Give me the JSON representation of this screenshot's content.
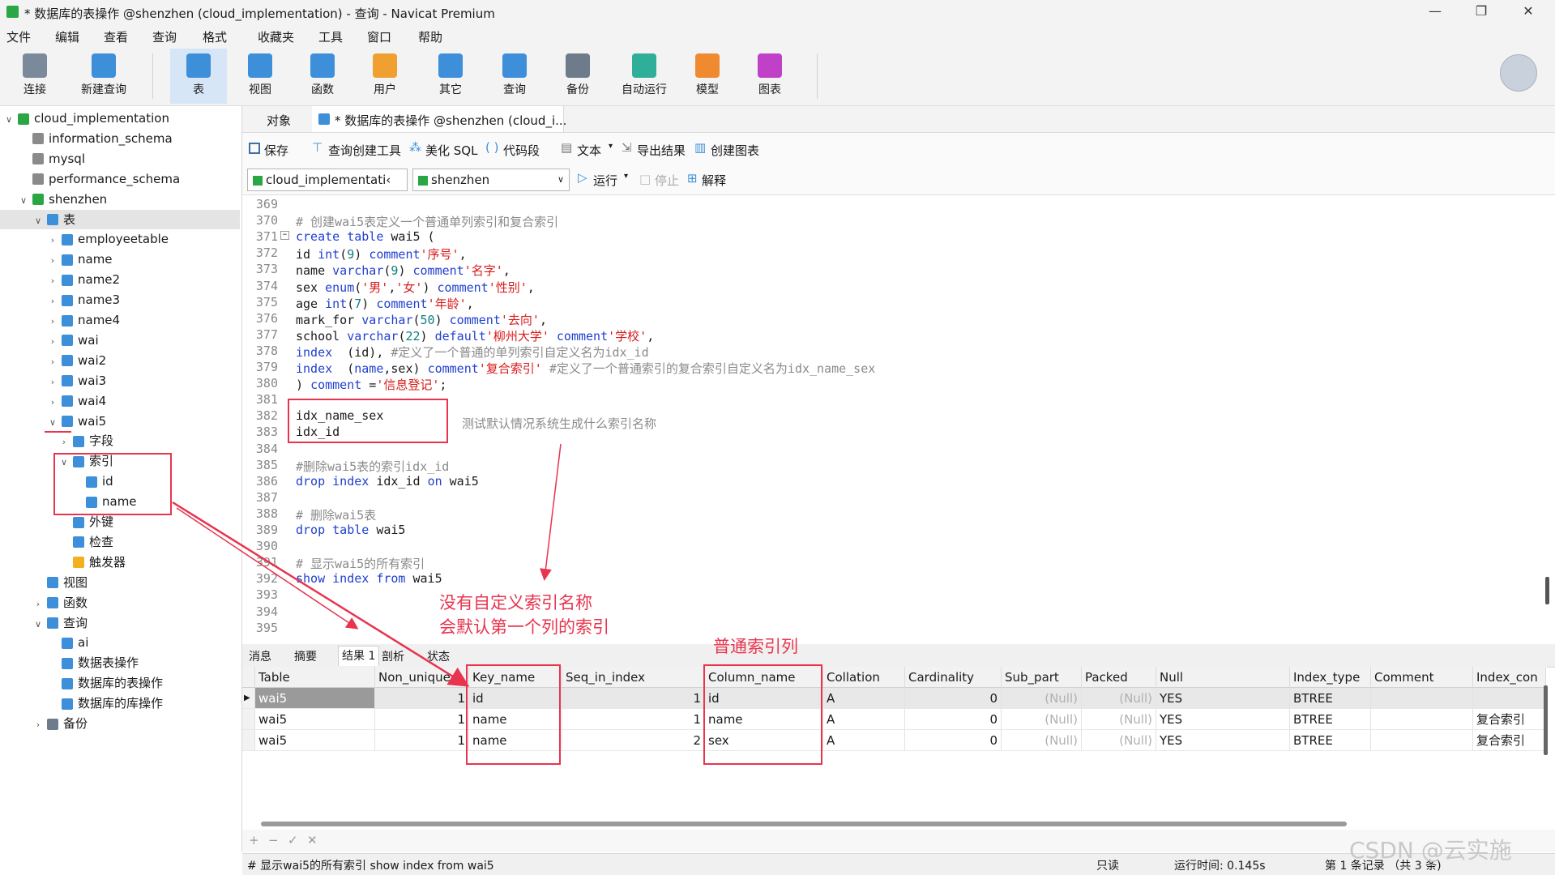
{
  "window": {
    "title": "* 数据库的表操作 @shenzhen (cloud_implementation) - 查询 - Navicat Premium",
    "minimize": "—",
    "maximize": "❐",
    "close": "✕"
  },
  "menu": [
    "文件",
    "编辑",
    "查看",
    "查询",
    "格式",
    "收藏夹",
    "工具",
    "窗口",
    "帮助"
  ],
  "toolbar": [
    {
      "label": "连接",
      "icon": "connect-icon",
      "color": "#7a8a9a"
    },
    {
      "label": "新建查询",
      "icon": "new-query-icon",
      "color": "#3d8fd9"
    },
    {
      "label": "表",
      "icon": "table-icon",
      "color": "#3d8fd9"
    },
    {
      "label": "视图",
      "icon": "view-icon",
      "color": "#3d8fd9"
    },
    {
      "label": "函数",
      "icon": "function-icon",
      "color": "#3d8fd9"
    },
    {
      "label": "用户",
      "icon": "user-icon",
      "color": "#f0a030"
    },
    {
      "label": "其它",
      "icon": "other-icon",
      "color": "#3d8fd9"
    },
    {
      "label": "查询",
      "icon": "query-icon",
      "color": "#3d8fd9"
    },
    {
      "label": "备份",
      "icon": "backup-icon",
      "color": "#6d7b8a"
    },
    {
      "label": "自动运行",
      "icon": "automation-icon",
      "color": "#2fae9a"
    },
    {
      "label": "模型",
      "icon": "model-icon",
      "color": "#f08a30"
    },
    {
      "label": "图表",
      "icon": "chart-icon",
      "color": "#c040c8"
    }
  ],
  "sidebar": {
    "items": [
      {
        "label": "cloud_implementation",
        "level": 0,
        "arrow": "∨",
        "icon": "connection-icon",
        "color": "#2aa645"
      },
      {
        "label": "information_schema",
        "level": 1,
        "arrow": "",
        "icon": "database-icon",
        "color": "#8a8a8a"
      },
      {
        "label": "mysql",
        "level": 1,
        "arrow": "",
        "icon": "database-icon",
        "color": "#8a8a8a"
      },
      {
        "label": "performance_schema",
        "level": 1,
        "arrow": "",
        "icon": "database-icon",
        "color": "#8a8a8a"
      },
      {
        "label": "shenzhen",
        "level": 1,
        "arrow": "∨",
        "icon": "database-icon",
        "color": "#2aa645"
      },
      {
        "label": "表",
        "level": 2,
        "arrow": "∨",
        "icon": "tables-icon",
        "color": "#3d8fd9"
      },
      {
        "label": "employeetable",
        "level": 3,
        "arrow": "›",
        "icon": "table-icon",
        "color": "#3d8fd9"
      },
      {
        "label": "name",
        "level": 3,
        "arrow": "›",
        "icon": "table-icon",
        "color": "#3d8fd9"
      },
      {
        "label": "name2",
        "level": 3,
        "arrow": "›",
        "icon": "table-icon",
        "color": "#3d8fd9"
      },
      {
        "label": "name3",
        "level": 3,
        "arrow": "›",
        "icon": "table-icon",
        "color": "#3d8fd9"
      },
      {
        "label": "name4",
        "level": 3,
        "arrow": "›",
        "icon": "table-icon",
        "color": "#3d8fd9"
      },
      {
        "label": "wai",
        "level": 3,
        "arrow": "›",
        "icon": "table-icon",
        "color": "#3d8fd9"
      },
      {
        "label": "wai2",
        "level": 3,
        "arrow": "›",
        "icon": "table-icon",
        "color": "#3d8fd9"
      },
      {
        "label": "wai3",
        "level": 3,
        "arrow": "›",
        "icon": "table-icon",
        "color": "#3d8fd9"
      },
      {
        "label": "wai4",
        "level": 3,
        "arrow": "›",
        "icon": "table-icon",
        "color": "#3d8fd9"
      },
      {
        "label": "wai5",
        "level": 3,
        "arrow": "∨",
        "icon": "table-icon",
        "color": "#3d8fd9"
      },
      {
        "label": "字段",
        "level": 4,
        "arrow": "›",
        "icon": "fields-icon",
        "color": "#3d8fd9"
      },
      {
        "label": "索引",
        "level": 4,
        "arrow": "∨",
        "icon": "index-icon",
        "color": "#3d8fd9"
      },
      {
        "label": "id",
        "level": 5,
        "arrow": "",
        "icon": "index-icon",
        "color": "#3d8fd9"
      },
      {
        "label": "name",
        "level": 5,
        "arrow": "",
        "icon": "index-icon",
        "color": "#3d8fd9"
      },
      {
        "label": "外键",
        "level": 4,
        "arrow": "",
        "icon": "foreign-key-icon",
        "color": "#3d8fd9"
      },
      {
        "label": "检查",
        "level": 4,
        "arrow": "",
        "icon": "check-icon",
        "color": "#3d8fd9"
      },
      {
        "label": "触发器",
        "level": 4,
        "arrow": "",
        "icon": "trigger-icon",
        "color": "#f0b020"
      },
      {
        "label": "视图",
        "level": 2,
        "arrow": "",
        "icon": "views-icon",
        "color": "#3d8fd9"
      },
      {
        "label": "函数",
        "level": 2,
        "arrow": "›",
        "icon": "functions-icon",
        "color": "#3d8fd9"
      },
      {
        "label": "查询",
        "level": 2,
        "arrow": "∨",
        "icon": "queries-icon",
        "color": "#3d8fd9"
      },
      {
        "label": "ai",
        "level": 3,
        "arrow": "",
        "icon": "query-icon",
        "color": "#3d8fd9"
      },
      {
        "label": "数据表操作",
        "level": 3,
        "arrow": "",
        "icon": "query-icon",
        "color": "#3d8fd9"
      },
      {
        "label": "数据库的表操作",
        "level": 3,
        "arrow": "",
        "icon": "query-icon",
        "color": "#3d8fd9"
      },
      {
        "label": "数据库的库操作",
        "level": 3,
        "arrow": "",
        "icon": "query-icon",
        "color": "#3d8fd9"
      },
      {
        "label": "备份",
        "level": 2,
        "arrow": "›",
        "icon": "backup-icon",
        "color": "#6d7b8a"
      }
    ]
  },
  "tabs": {
    "objects": "对象",
    "query_tab": "* 数据库的表操作 @shenzhen (cloud_i..."
  },
  "editor_toolbar": {
    "save": "保存",
    "query_builder": "查询创建工具",
    "beautify": "美化 SQL",
    "snippet": "代码段",
    "text": "文本",
    "export": "导出结果",
    "create_chart": "创建图表"
  },
  "run_bar": {
    "connection": "cloud_implementati‹",
    "database": "shenzhen",
    "run": "运行",
    "stop": "停止",
    "explain": "解释"
  },
  "editor": {
    "lines": [
      {
        "n": "369",
        "html": ""
      },
      {
        "n": "370",
        "html": "<span class='cm'># 创建wai5表定义一个普通单列索引和复合索引</span>"
      },
      {
        "n": "371",
        "html": "<span class='kw'>create table</span> wai5 ("
      },
      {
        "n": "372",
        "html": "id <span class='kw'>int</span>(<span class='num'>9</span>) <span class='kw'>comment</span><span class='str'>'序号'</span>,"
      },
      {
        "n": "373",
        "html": "name <span class='kw'>varchar</span>(<span class='num'>9</span>) <span class='kw'>comment</span><span class='str'>'名字'</span>,"
      },
      {
        "n": "374",
        "html": "sex <span class='kw'>enum</span>(<span class='str'>'男'</span>,<span class='str'>'女'</span>) <span class='kw'>comment</span><span class='str'>'性别'</span>,"
      },
      {
        "n": "375",
        "html": "age <span class='kw'>int</span>(<span class='num'>7</span>) <span class='kw'>comment</span><span class='str'>'年龄'</span>,"
      },
      {
        "n": "376",
        "html": "mark_for <span class='kw'>varchar</span>(<span class='num'>50</span>) <span class='kw'>comment</span><span class='str'>'去向'</span>,"
      },
      {
        "n": "377",
        "html": "school <span class='kw'>varchar</span>(<span class='num'>22</span>) <span class='kw'>default</span><span class='str'>'柳州大学'</span> <span class='kw'>comment</span><span class='str'>'学校'</span>,"
      },
      {
        "n": "378",
        "html": "<span class='kw'>index</span>  (id), <span class='cm'>#定义了一个普通的单列索引自定义名为idx_id</span>"
      },
      {
        "n": "379",
        "html": "<span class='kw'>index</span>  (<span class='kw'>name</span>,sex) <span class='kw'>comment</span><span class='str'>'复合索引'</span> <span class='cm'>#定义了一个普通索引的复合索引自定义名为idx_name_sex</span>"
      },
      {
        "n": "380",
        "html": ") <span class='kw'>comment</span> =<span class='str'>'信息登记'</span>;"
      },
      {
        "n": "381",
        "html": ""
      },
      {
        "n": "382",
        "html": "idx_name_sex"
      },
      {
        "n": "383",
        "html": "idx_id"
      },
      {
        "n": "384",
        "html": ""
      },
      {
        "n": "385",
        "html": "<span class='cm'>#删除wai5表的索引idx_id</span>"
      },
      {
        "n": "386",
        "html": "<span class='kw'>drop index</span> idx_id <span class='kw'>on</span> wai5"
      },
      {
        "n": "387",
        "html": ""
      },
      {
        "n": "388",
        "html": "<span class='cm'># 删除wai5表</span>"
      },
      {
        "n": "389",
        "html": "<span class='kw'>drop table</span> wai5"
      },
      {
        "n": "390",
        "html": ""
      },
      {
        "n": "391",
        "html": "<span class='cm'># 显示wai5的所有索引</span>"
      },
      {
        "n": "392",
        "html": "<span class='kw'>show index from</span> wai5"
      },
      {
        "n": "393",
        "html": ""
      },
      {
        "n": "394",
        "html": ""
      },
      {
        "n": "395",
        "html": ""
      }
    ]
  },
  "result_tabs": [
    "消息",
    "摘要",
    "结果 1",
    "剖析",
    "状态"
  ],
  "grid": {
    "columns": [
      "Table",
      "Non_unique",
      "Key_name",
      "Seq_in_index",
      "Column_name",
      "Collation",
      "Cardinality",
      "Sub_part",
      "Packed",
      "Null",
      "Index_type",
      "Comment",
      "Index_con"
    ],
    "rows": [
      [
        "wai5",
        "1",
        "id",
        "1",
        "id",
        "A",
        "0",
        "(Null)",
        "(Null)",
        "YES",
        "BTREE",
        "",
        ""
      ],
      [
        "wai5",
        "1",
        "name",
        "1",
        "name",
        "A",
        "0",
        "(Null)",
        "(Null)",
        "YES",
        "BTREE",
        "",
        "复合索引"
      ],
      [
        "wai5",
        "1",
        "name",
        "2",
        "sex",
        "A",
        "0",
        "(Null)",
        "(Null)",
        "YES",
        "BTREE",
        "",
        "复合索引"
      ]
    ]
  },
  "grid_footer": [
    "+",
    "−",
    "✓",
    "✕"
  ],
  "status": {
    "sql": "# 显示wai5的所有索引 show index from wai5",
    "readonly": "只读",
    "time": "运行时间: 0.145s",
    "records": "第 1 条记录 （共 3 条)"
  },
  "annotations": {
    "note1": "测试默认情况系统生成什么索引名称",
    "note2_line1": "没有自定义索引名称",
    "note2_line2": "会默认第一个列的索引",
    "note3": "普通索引列"
  },
  "watermark": "CSDN @云实施"
}
